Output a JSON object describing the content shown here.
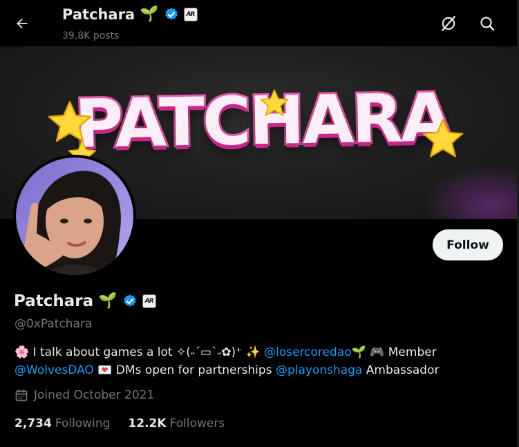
{
  "header": {
    "name": "Patchara",
    "name_emoji": "🌱",
    "posts_count": "39.8K posts",
    "affiliate_badge": "AR"
  },
  "icons": {
    "back": "back-arrow-icon",
    "grok": "grok-icon",
    "search": "search-icon",
    "verified": "verified-badge-icon",
    "calendar": "calendar-icon"
  },
  "banner": {
    "title": "PATCHARA"
  },
  "profile": {
    "name": "Patchara",
    "name_emoji": "🌱",
    "handle": "@0xPatchara",
    "affiliate_badge": "AR"
  },
  "follow_button": {
    "label": "Follow"
  },
  "bio": {
    "flower_emoji": "🌸",
    "text1": " I talk about games a lot ✧(˶´▭`˶✿)⁺ ",
    "sparkle_emoji": "✨",
    "link1": "@losercoredao",
    "sprout_emoji": "🌱",
    "gamepad_emoji": "🎮",
    "text2": " Member ",
    "link2": "@WolvesDAO",
    "letter_emoji": "💌",
    "text3": " DMs open for partnerships ",
    "link3": "@playonshaga",
    "text4": " Ambassador"
  },
  "joined": {
    "text": "Joined October 2021"
  },
  "stats": {
    "following_count": "2,734",
    "following_label": "Following",
    "followers_count": "12.2K",
    "followers_label": "Followers"
  },
  "colors": {
    "background": "#000000",
    "text_primary": "#e7e9ea",
    "text_secondary": "#71767b",
    "link": "#1d9bf0",
    "verified": "#1d9bf0",
    "follow_button_bg": "#eff3f4",
    "banner_pink": "#f35fb6",
    "star_yellow": "#ffd93b"
  }
}
